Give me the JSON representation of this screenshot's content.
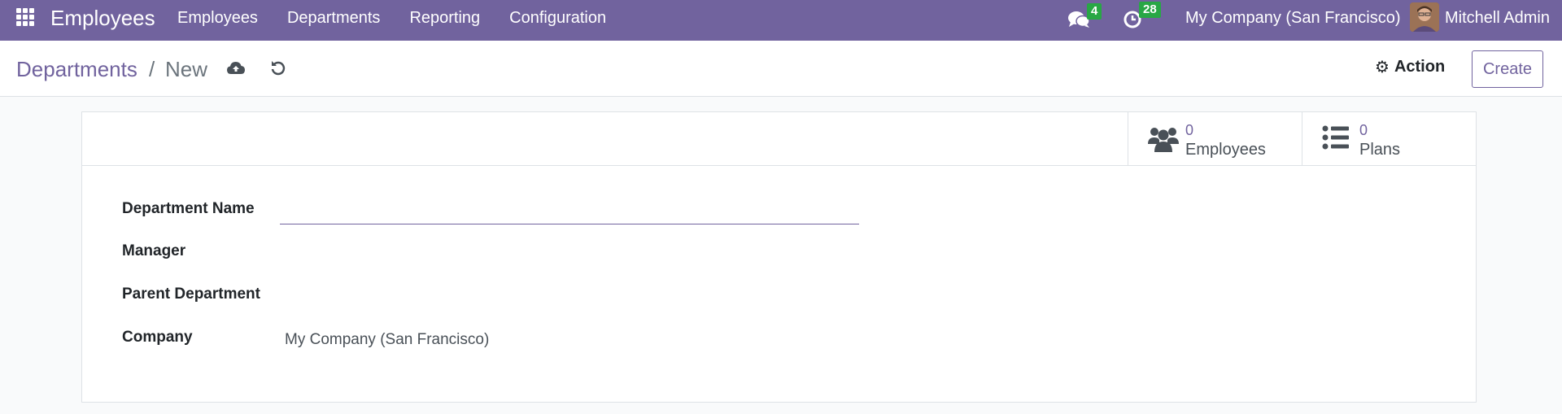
{
  "navbar": {
    "app_name": "Employees",
    "menu": [
      "Employees",
      "Departments",
      "Reporting",
      "Configuration"
    ],
    "messages_count": "4",
    "activities_count": "28",
    "company": "My Company (San Francisco)",
    "user": "Mitchell Admin"
  },
  "breadcrumb": {
    "parent": "Departments",
    "separator": "/",
    "current": "New"
  },
  "control": {
    "action_label": "Action",
    "create_label": "Create"
  },
  "stats": {
    "employees": {
      "value": "0",
      "label": "Employees"
    },
    "plans": {
      "value": "0",
      "label": "Plans"
    }
  },
  "form": {
    "department_name_label": "Department Name",
    "department_name_value": "",
    "manager_label": "Manager",
    "manager_value": "",
    "parent_label": "Parent Department",
    "parent_value": "",
    "company_label": "Company",
    "company_value": "My Company (San Francisco)"
  },
  "colors": {
    "brand": "#71639e",
    "badge": "#28a745"
  },
  "icons": {
    "apps": "apps-grid-icon",
    "chat": "chat-bubbles-icon",
    "activity": "clock-icon",
    "save": "cloud-upload-icon",
    "discard": "undo-icon",
    "action": "gear-icon",
    "employees": "users-icon",
    "plans": "list-icon"
  }
}
